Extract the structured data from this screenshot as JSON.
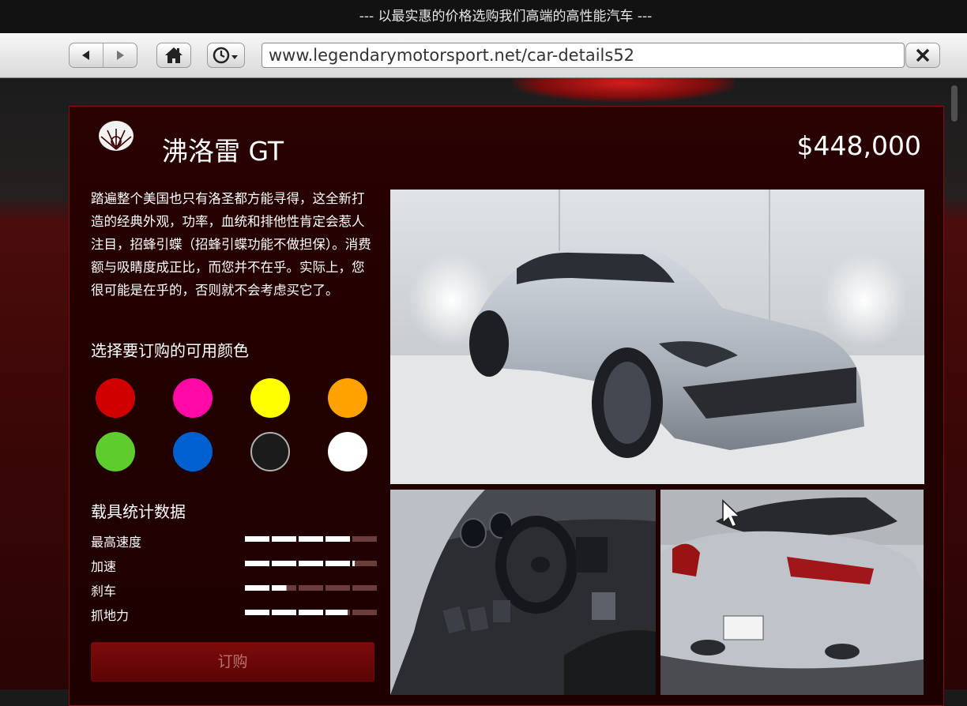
{
  "window": {
    "title": "--- 以最实惠的价格选购我们高端的高性能汽车 ---"
  },
  "toolbar": {
    "url": "www.legendarymotorsport.net/car-details52",
    "icons": [
      "back-arrow-icon",
      "forward-arrow-icon",
      "home-icon",
      "history-clock-icon",
      "close-x-icon"
    ]
  },
  "vehicle": {
    "brand_logo_text": "Lampadati",
    "name": "沸洛雷 GT",
    "price": "$448,000",
    "description": "踏遍整个美国也只有洛圣都方能寻得，这全新打造的经典外观，功率，血统和排他性肯定会惹人注目，招蜂引蝶（招蜂引蝶功能不做担保）。消费额与吸睛度成正比，而您并不在乎。实际上，您很可能是在乎的，否则就不会考虑买它了。"
  },
  "colors": {
    "heading": "选择要订购的可用颜色",
    "swatches": [
      "#d00000",
      "#ff0aa6",
      "#ffff00",
      "#ffa200",
      "#5fcc2e",
      "#0060d0",
      "#1b1b1b",
      "#ffffff"
    ],
    "selected_index": 6
  },
  "stats": {
    "heading": "载具统计数据",
    "items": [
      {
        "label": "最高速度",
        "level": 0.8
      },
      {
        "label": "加速",
        "level": 0.82
      },
      {
        "label": "刹车",
        "level": 0.32
      },
      {
        "label": "抓地力",
        "level": 0.78
      }
    ]
  },
  "order": {
    "button_label": "订购"
  },
  "theme": {
    "panel_bg": "#220000",
    "accent": "#7d0b0b",
    "button_text": "#b7736f"
  }
}
